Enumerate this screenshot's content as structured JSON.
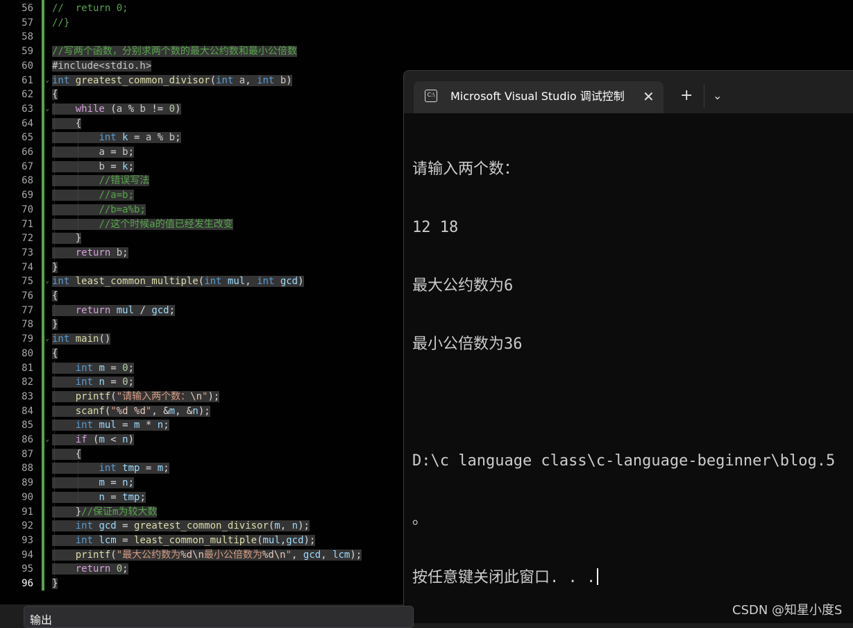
{
  "editor": {
    "line_numbers": [
      "56",
      "57",
      "58",
      "59",
      "60",
      "61",
      "62",
      "63",
      "64",
      "65",
      "66",
      "67",
      "68",
      "69",
      "70",
      "71",
      "72",
      "73",
      "74",
      "75",
      "76",
      "77",
      "78",
      "79",
      "80",
      "81",
      "82",
      "83",
      "84",
      "85",
      "86",
      "87",
      "88",
      "89",
      "90",
      "91",
      "92",
      "93",
      "94",
      "95",
      "96"
    ],
    "code_lines": [
      "//  return 0;",
      "//}",
      "",
      "//写两个函数，分别求两个数的最大公约数和最小公倍数",
      "#include<stdio.h>",
      "int greatest_common_divisor(int a, int b)",
      "{",
      "    while (a % b != 0)",
      "    {",
      "        int k = a % b;",
      "        a = b;",
      "        b = k;",
      "        //错误写法",
      "        //a=b;",
      "        //b=a%b;",
      "        //这个时候a的值已经发生改变",
      "    }",
      "    return b;",
      "}",
      "int least_common_multiple(int mul, int gcd)",
      "{",
      "    return mul / gcd;",
      "}",
      "int main()",
      "{",
      "    int m = 0;",
      "    int n = 0;",
      "    printf(\"请输入两个数：\\n\");",
      "    scanf(\"%d %d\", &m, &n);",
      "    int mul = m * n;",
      "    if (m < n)",
      "    {",
      "        int tmp = m;",
      "        m = n;",
      "        n = tmp;",
      "    }//保证m为较大数",
      "    int gcd = greatest_common_divisor(m, n);",
      "    int lcm = least_common_multiple(mul,gcd);",
      "    printf(\"最大公约数为%d\\n最小公倍数为%d\\n\", gcd, lcm);",
      "    return 0;",
      "}"
    ]
  },
  "terminal": {
    "tab_title": "Microsoft Visual Studio 调试控制台",
    "tab_icon_text": "C:\\",
    "close_glyph": "✕",
    "new_tab_glyph": "+",
    "dropdown_glyph": "⌄",
    "lines": [
      "请输入两个数：",
      "12 18",
      "最大公约数为6",
      "最小公倍数为36",
      "",
      "D:\\c language class\\c-language-beginner\\blog.5",
      "。",
      "按任意键关闭此窗口. . ."
    ]
  },
  "output_panel": {
    "label": "输出"
  },
  "watermark": "CSDN @知星小度S"
}
